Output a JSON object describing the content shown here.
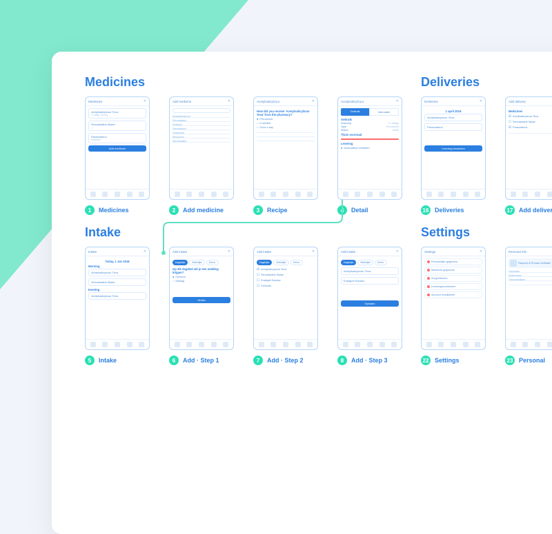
{
  "sections": {
    "a": "Medicines",
    "b": "Intake",
    "c": "Deliveries",
    "d": "Settings"
  },
  "screens": {
    "s1": {
      "num": "1",
      "label": "Medicines",
      "title": "Medicines"
    },
    "s2": {
      "num": "2",
      "label": "Add medicine",
      "title": "Add medicine"
    },
    "s3": {
      "num": "3",
      "label": "Recipe",
      "title": "Acetylsalicylzuur"
    },
    "s4": {
      "num": "4",
      "label": "Detail",
      "title": "Acetylsalicylzuur"
    },
    "s5": {
      "num": "5",
      "label": "Intake",
      "title": "Intake"
    },
    "s6": {
      "num": "6",
      "label": "Add · Step 1",
      "title": "Add intake"
    },
    "s7": {
      "num": "7",
      "label": "Add · Step 2",
      "title": "Add intake"
    },
    "s8": {
      "num": "8",
      "label": "Add · Step 3",
      "title": "Add intake"
    },
    "s16": {
      "num": "16",
      "label": "Deliveries",
      "title": "Deliveries"
    },
    "s17": {
      "num": "17",
      "label": "Add delivery",
      "title": "Add delivery"
    },
    "s22": {
      "num": "22",
      "label": "Settings",
      "title": "Settings"
    },
    "s23": {
      "num": "23",
      "label": "Personal",
      "title": "Personal info"
    }
  },
  "meds": {
    "m1": {
      "name": "Acetylsalicylzuur Teva",
      "sub": "1× daily, 100 mg"
    },
    "m2": {
      "name": "Simvastatine Mylan",
      "sub": "—"
    },
    "m3": {
      "name": "Paracetamol",
      "sub": "if needed"
    }
  },
  "intake": {
    "date": "Today, 1 Jan 2018",
    "morning": "Morning",
    "evening": "Evening"
  },
  "recipe": {
    "q": "How did you receive 'Acetylsalicylzuur Teva' from the pharmacy?",
    "r1": "Permanent",
    "r2": "If needed",
    "r3": "Once a day"
  },
  "detail": {
    "tab_on": "Gebruik",
    "tab_off": "Informatie",
    "s1": "Gebruik",
    "s2": "Thuis voorraad",
    "s3": "Levering",
    "k1": "Dosering",
    "v1": "1× daags",
    "k2": "Type",
    "v2": "Permanent",
    "k3": "Status",
    "v3": "Actief"
  },
  "deliveries": {
    "date": "1 april 2019",
    "item1": "Acetylsalicylzuur Teva",
    "item2": "Paracetamol",
    "btn": "Levering bewerken"
  },
  "addIntake": {
    "q6": "Op elk dagdeel wil je een melding krijgen?",
    "opt1": "Ochtend",
    "opt2": "Middag",
    "pill1": "Dagelijks",
    "pill2": "Wekelijks",
    "pill3": "Eénm.",
    "list7a": "Acetylsalicylzuur Teva",
    "list7b": "Simvastatine Mylan",
    "list7c": "Enalapril Sandoz",
    "list7d": "Celluvisc",
    "btn_next": "Verder",
    "btn_save": "Opslaan"
  },
  "settings_rows": {
    "r1": "Persoonlijke gegevens",
    "r2": "Medische gegevens",
    "r3": "Zorgverleners",
    "r4": "Leveringsvoorkeuren",
    "r5": "Account verwijderen"
  },
  "personal": {
    "h": "Personal info"
  },
  "btn_add_med": "Add medicine"
}
